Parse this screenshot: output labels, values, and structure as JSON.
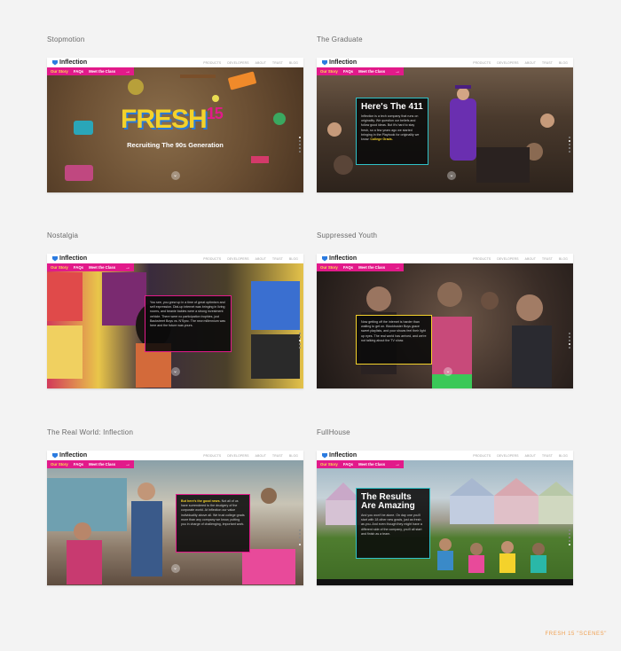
{
  "nav": {
    "brand": "Inflection",
    "links": [
      "PRODUCTS",
      "DEVELOPERS",
      "ABOUT",
      "TRUST",
      "BLOG"
    ],
    "sub": [
      "Our Story",
      "FAQs",
      "Meet the Class"
    ],
    "arrow": "→"
  },
  "cards": [
    {
      "title": "Stopmotion"
    },
    {
      "title": "The Graduate"
    },
    {
      "title": "Nostalgia"
    },
    {
      "title": "Suppressed Youth"
    },
    {
      "title": "The Real World: Inflection"
    },
    {
      "title": "FullHouse"
    }
  ],
  "scene1": {
    "headline": "FRESH",
    "headline_num": "15",
    "tagline": "Recruiting The 90s Generation"
  },
  "scene2": {
    "heading": "Here's The 411",
    "body": "Inflection is a tech company that runs on originality. We question our beliefs and follow good ideas. But it's hard to stay fresh, so a few years ago we started bringing in the Playbook for originality we know:",
    "highlight": "College Grads."
  },
  "scene3": {
    "body": "You see, you grew up in a time of great optimism and self expression. Dial-up internet was bringing in living rooms, and beanie babies were a strong investment vehicle. There were no participation trophies, just Backstreet Boys vs. N'Sync. The new millennium was here and the future was yours."
  },
  "scene4": {
    "body": "Now getting off the internet is harder than waiting to get on. Blockbuster Boys grace sweet playlists, and your shows feel their light up eyes. The real world has arrived, and we're not talking about the TV show."
  },
  "scene5": {
    "highlight": "But here's the good news.",
    "body": "Not all of us have surrendered to the drudgery of the corporate world. At Inflection our value individuality above all. We trust college grads more than any company we know, putting you in charge of challenging, important work."
  },
  "scene6": {
    "heading": "The Results Are Amazing",
    "body": "And you won't be alone. On day one you'll start with 18 other new grads, just as fresh as you. And even though they might have a different side of the company, you'll all start and finish as a team."
  },
  "footer": "FRESH 15 \"SCENES\"",
  "colors": {
    "magenta": "#e21a8a",
    "yellow": "#f4d22b",
    "brand_blue": "#2b7be0",
    "footer": "#f0a050"
  }
}
